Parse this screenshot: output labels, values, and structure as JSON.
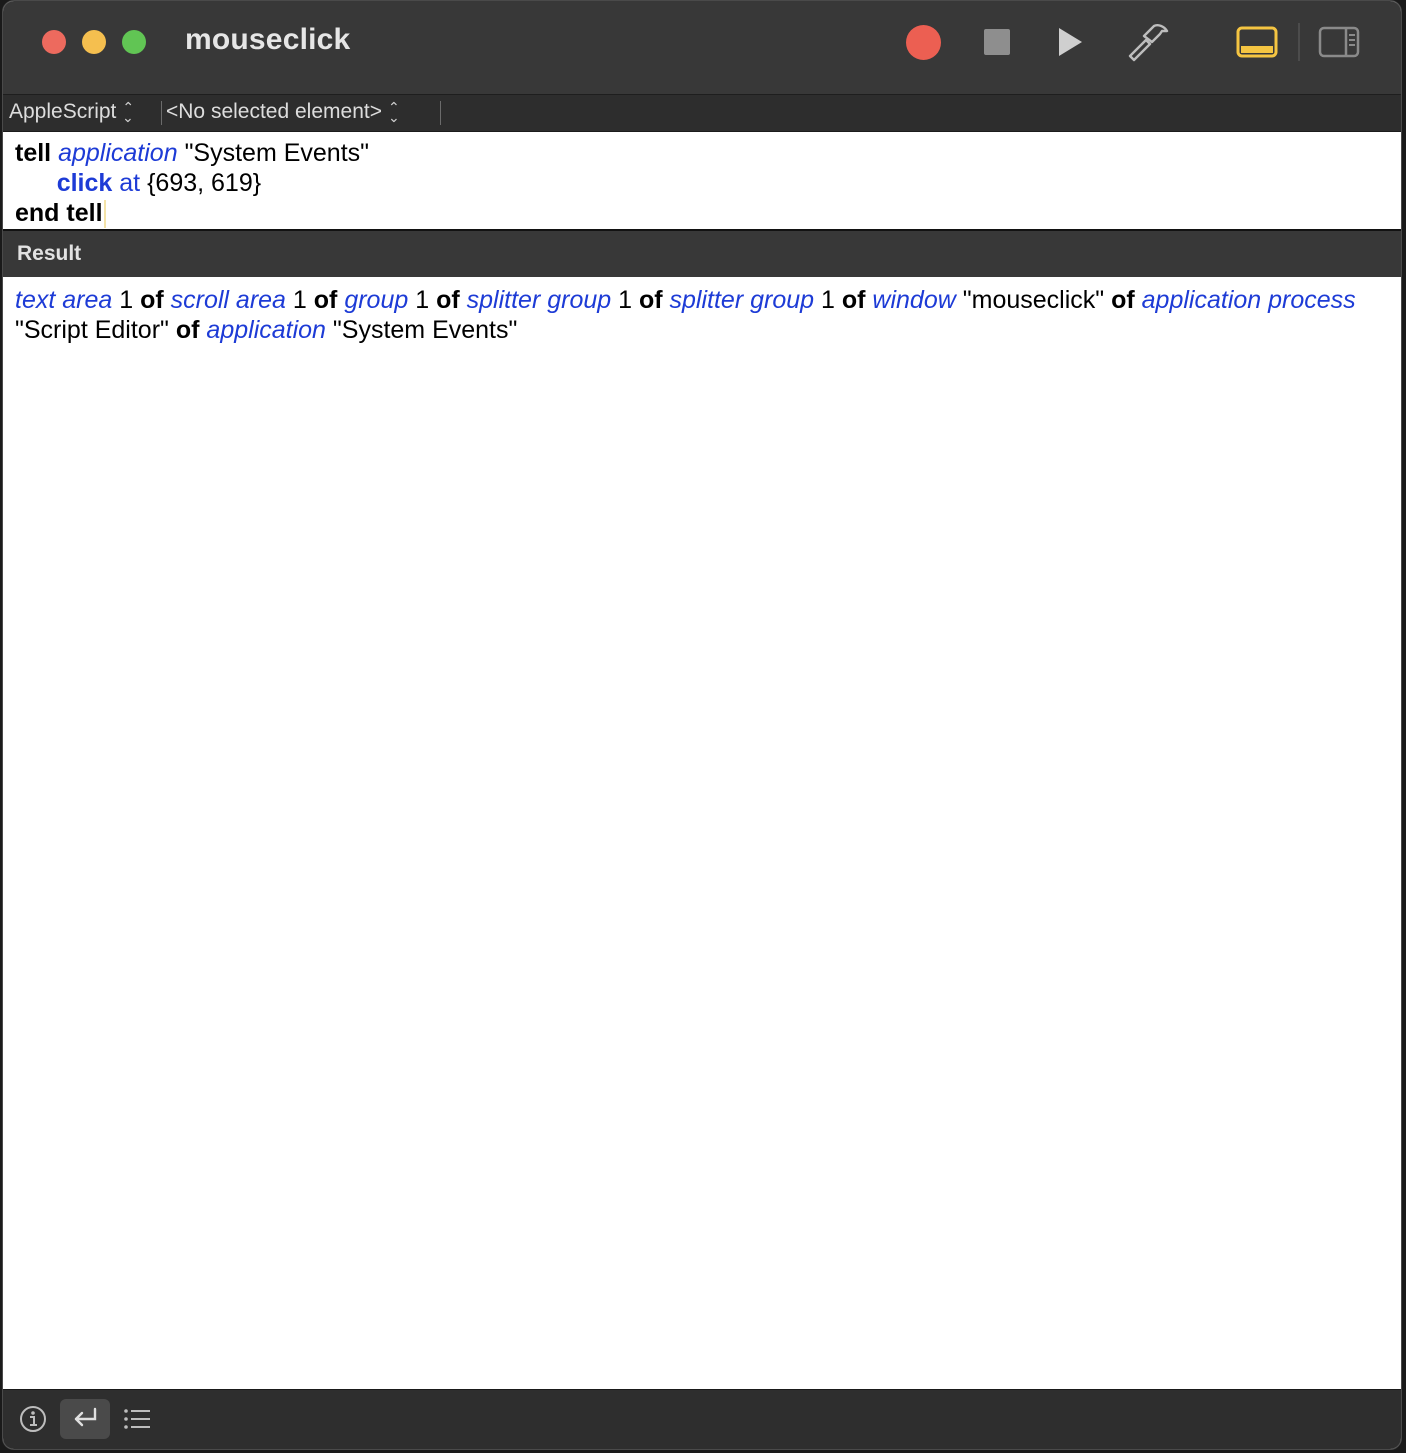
{
  "window": {
    "title": "mouseclick"
  },
  "toolbar": {
    "record_icon": "record-icon",
    "stop_icon": "stop-icon",
    "run_icon": "play-icon",
    "compile_icon": "hammer-icon",
    "bottom_pane_icon": "bottom-pane-icon",
    "side_pane_icon": "sidebar-icon",
    "accent_color": "#f5c542"
  },
  "navbar": {
    "language": "AppleScript",
    "element": "<No selected element>"
  },
  "editor": {
    "line1": {
      "kw_tell": "tell",
      "cls_application": "application",
      "lit_target": "\"System Events\""
    },
    "line2": {
      "indent": "      ",
      "cmd_click": "click",
      "param_at": "at",
      "lit_coords": "{693, 619}"
    },
    "line3": {
      "kw_end_tell": "end tell"
    }
  },
  "result": {
    "header": "Result",
    "tokens": [
      {
        "t": "text area",
        "c": "cls"
      },
      {
        "t": " 1 ",
        "c": "lit"
      },
      {
        "t": "of",
        "c": "kw"
      },
      {
        "t": " ",
        "c": "lit"
      },
      {
        "t": "scroll area",
        "c": "cls"
      },
      {
        "t": " 1 ",
        "c": "lit"
      },
      {
        "t": "of",
        "c": "kw"
      },
      {
        "t": " ",
        "c": "lit"
      },
      {
        "t": "group",
        "c": "cls"
      },
      {
        "t": " 1 ",
        "c": "lit"
      },
      {
        "t": "of",
        "c": "kw"
      },
      {
        "t": " ",
        "c": "lit"
      },
      {
        "t": "splitter group",
        "c": "cls"
      },
      {
        "t": " 1 ",
        "c": "lit"
      },
      {
        "t": "of",
        "c": "kw"
      },
      {
        "t": " ",
        "c": "lit"
      },
      {
        "t": "splitter group",
        "c": "cls"
      },
      {
        "t": " 1 ",
        "c": "lit"
      },
      {
        "t": "of",
        "c": "kw"
      },
      {
        "t": " ",
        "c": "lit"
      },
      {
        "t": "window",
        "c": "cls"
      },
      {
        "t": " \"mouseclick\" ",
        "c": "lit"
      },
      {
        "t": "of",
        "c": "kw"
      },
      {
        "t": " ",
        "c": "lit"
      },
      {
        "t": "application process",
        "c": "cls"
      },
      {
        "t": " \"Script Editor\" ",
        "c": "lit"
      },
      {
        "t": "of",
        "c": "kw"
      },
      {
        "t": " ",
        "c": "lit"
      },
      {
        "t": "application",
        "c": "cls"
      },
      {
        "t": " \"System Events\"",
        "c": "lit"
      }
    ]
  },
  "bottombar": {
    "info_icon": "info-icon",
    "return_icon": "return-arrow-icon",
    "list_icon": "list-icon"
  }
}
